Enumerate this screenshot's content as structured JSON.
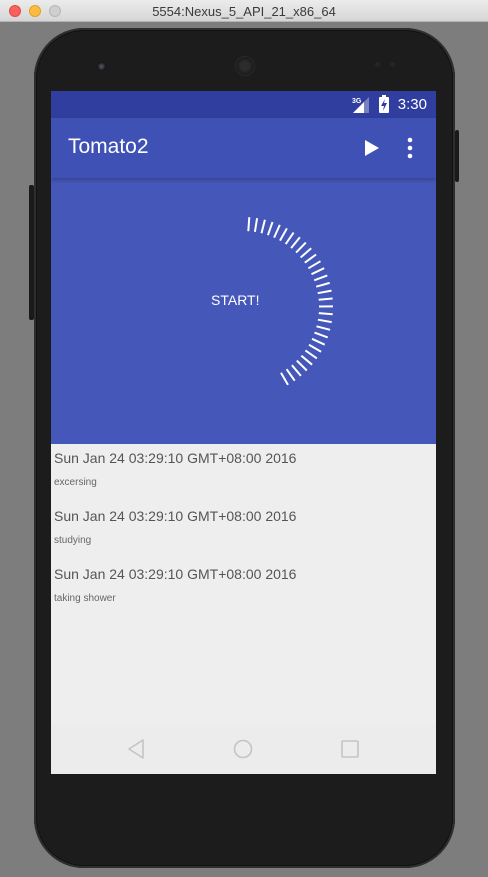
{
  "window": {
    "title": "5554:Nexus_5_API_21_x86_64"
  },
  "status_bar": {
    "network_label": "3G",
    "time": "3:30",
    "icons": [
      "signal-3g-icon",
      "battery-charging-icon"
    ]
  },
  "toolbar": {
    "title": "Tomato2",
    "actions": [
      "play-icon",
      "overflow-menu-icon"
    ]
  },
  "timer": {
    "start_label": "START!"
  },
  "records": [
    {
      "time": "Sun Jan 24 03:29:10 GMT+08:00 2016",
      "task": "excersing"
    },
    {
      "time": "Sun Jan 24 03:29:10 GMT+08:00 2016",
      "task": "studying"
    },
    {
      "time": "Sun Jan 24 03:29:10 GMT+08:00 2016",
      "task": "taking shower"
    }
  ],
  "nav_bar": {
    "icons": [
      "back-icon",
      "home-icon",
      "recents-icon"
    ]
  },
  "colors": {
    "status_bar": "#303f9f",
    "primary": "#3f51b5",
    "timer_background": "#4557b9",
    "list_background": "#eeeeee"
  }
}
